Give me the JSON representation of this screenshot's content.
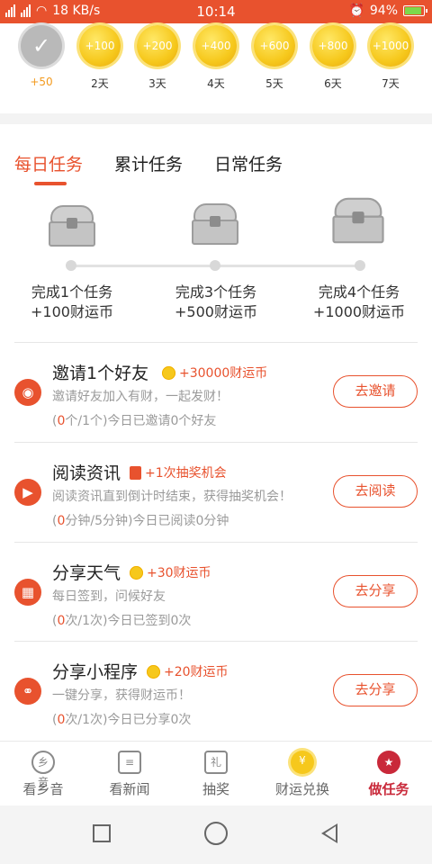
{
  "status_bar": {
    "network_speed": "18 KB/s",
    "time": "10:14",
    "battery": "94%"
  },
  "checkin": {
    "days": [
      {
        "reward": "✓",
        "label": "+50"
      },
      {
        "reward": "+100",
        "label": "2天"
      },
      {
        "reward": "+200",
        "label": "3天"
      },
      {
        "reward": "+400",
        "label": "4天"
      },
      {
        "reward": "+600",
        "label": "5天"
      },
      {
        "reward": "+800",
        "label": "6天"
      },
      {
        "reward": "+1000",
        "label": "7天"
      }
    ]
  },
  "tabs": [
    {
      "label": "每日任务",
      "active": true
    },
    {
      "label": "累计任务",
      "active": false
    },
    {
      "label": "日常任务",
      "active": false
    }
  ],
  "milestones": [
    {
      "line1": "完成1个任务",
      "line2": "+100财运币"
    },
    {
      "line1": "完成3个任务",
      "line2": "+500财运币"
    },
    {
      "line1": "完成4个任务",
      "line2": "+1000财运币"
    }
  ],
  "tasks": [
    {
      "icon": "invite-icon",
      "title": "邀请1个好友",
      "reward": "+30000财运币",
      "reward_icon": "coin-icon",
      "desc": "邀请好友加入有财，一起发财！",
      "prog_num": "0",
      "prog_text": "个/1个)今日已邀请0个好友",
      "button": "去邀请"
    },
    {
      "icon": "video-icon",
      "title": "阅读资讯",
      "reward": "+1次抽奖机会",
      "reward_icon": "ticket-icon",
      "desc": "阅读资讯直到倒计时结束，获得抽奖机会！",
      "prog_num": "0",
      "prog_text": "分钟/5分钟)今日已阅读0分钟",
      "button": "去阅读"
    },
    {
      "icon": "calendar-icon",
      "title": "分享天气",
      "reward": "+30财运币",
      "reward_icon": "coin-icon",
      "desc": "每日签到，问候好友",
      "prog_num": "0",
      "prog_text": "次/1次)今日已签到0次",
      "button": "去分享"
    },
    {
      "icon": "link-icon",
      "title": "分享小程序",
      "reward": "+20财运币",
      "reward_icon": "coin-icon",
      "desc": "一键分享，获得财运币！",
      "prog_num": "0",
      "prog_text": "次/1次)今日已分享0次",
      "button": "去分享"
    }
  ],
  "prog_open": "(",
  "bottom_nav": [
    {
      "label": "看乡音",
      "icon_text": "乡音"
    },
    {
      "label": "看新闻",
      "icon_text": "≡"
    },
    {
      "label": "抽奖",
      "icon_text": "礼"
    },
    {
      "label": "财运兑换",
      "icon_text": "¥"
    },
    {
      "label": "做任务",
      "icon_text": "★"
    }
  ],
  "colors": {
    "accent": "#e8522e",
    "active_nav": "#c9293a",
    "gold": "#f6c81c"
  }
}
